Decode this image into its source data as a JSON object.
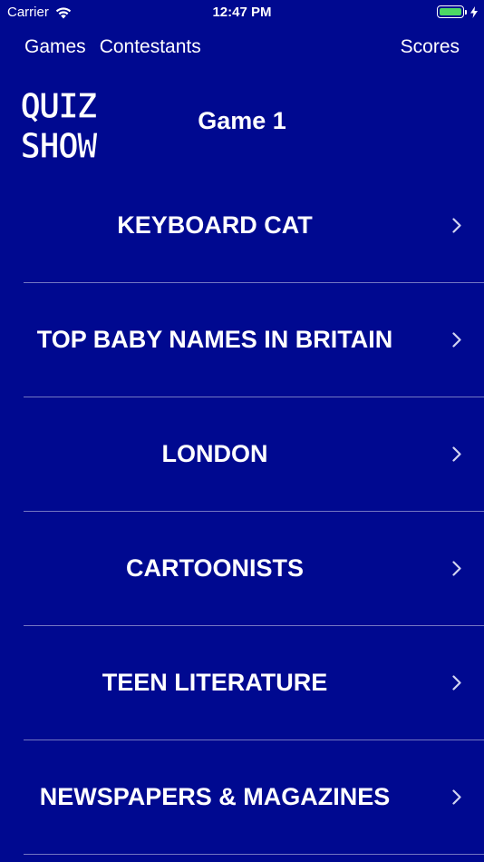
{
  "status_bar": {
    "carrier": "Carrier",
    "time": "12:47 PM",
    "battery_level": 1.0,
    "battery_color": "#4cd964"
  },
  "nav": {
    "games": "Games",
    "contestants": "Contestants",
    "scores": "Scores"
  },
  "header": {
    "logo_line1": "QUIZ",
    "logo_line2": "SHOW",
    "game_title": "Game 1"
  },
  "categories": [
    {
      "label": "KEYBOARD CAT"
    },
    {
      "label": "TOP BABY NAMES IN BRITAIN"
    },
    {
      "label": "LONDON"
    },
    {
      "label": "CARTOONISTS"
    },
    {
      "label": "TEEN LITERATURE"
    },
    {
      "label": "NEWSPAPERS & MAGAZINES"
    }
  ],
  "colors": {
    "background": "#000990",
    "text": "#ffffff",
    "separator": "#8088c8"
  },
  "icons": [
    "wifi-icon",
    "battery-icon",
    "charging-bolt-icon",
    "chevron-right-icon"
  ]
}
